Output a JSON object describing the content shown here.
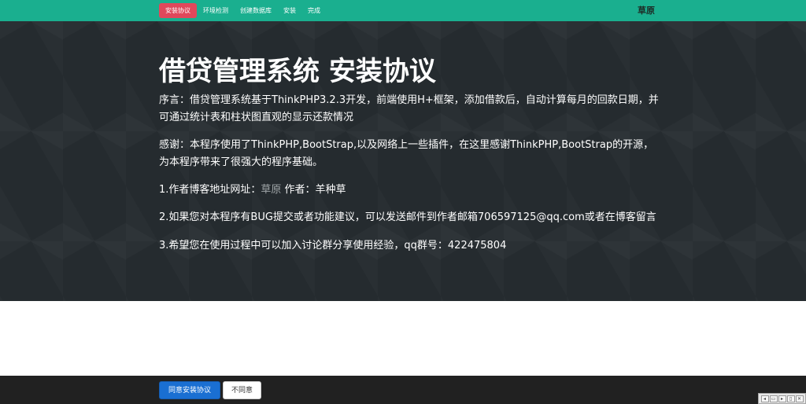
{
  "nav": {
    "items": [
      {
        "label": "安装协议",
        "active": true
      },
      {
        "label": "环境检测",
        "active": false
      },
      {
        "label": "创建数据库",
        "active": false
      },
      {
        "label": "安装",
        "active": false
      },
      {
        "label": "完成",
        "active": false
      }
    ],
    "brand": "草原"
  },
  "hero": {
    "title": "借贷管理系统 安装协议",
    "preface": "序言：借贷管理系统基于ThinkPHP3.2.3开发，前端使用H+框架，添加借款后，自动计算每月的回款日期，并可通过统计表和柱状图直观的显示还款情况",
    "thanks": "感谢：本程序使用了ThinkPHP,BootStrap,以及网络上一些插件，在这里感谢ThinkPHP,BootStrap的开源，为本程序带来了很强大的程序基础。",
    "item1_prefix": "1.作者博客地址网址：",
    "item1_link": "草原",
    "item1_suffix": " 作者：羊种草",
    "item2": "2.如果您对本程序有BUG提交或者功能建议，可以发送邮件到作者邮箱706597125@qq.com或者在博客留言",
    "item3": "3.希望您在使用过程中可以加入讨论群分享使用经验，qq群号：422475804"
  },
  "footer": {
    "agree_label": "同意安装协议",
    "disagree_label": "不同意"
  },
  "mini_toolbar": {
    "buttons": [
      "◂",
      "▭",
      "▸",
      "▯",
      "✕"
    ]
  },
  "colors": {
    "navbar": "#1aaf8f",
    "active_tab": "#e0485b",
    "hero_bg": "#252b2f",
    "footer_bg": "#212121",
    "primary_button": "#1a6fd2"
  }
}
